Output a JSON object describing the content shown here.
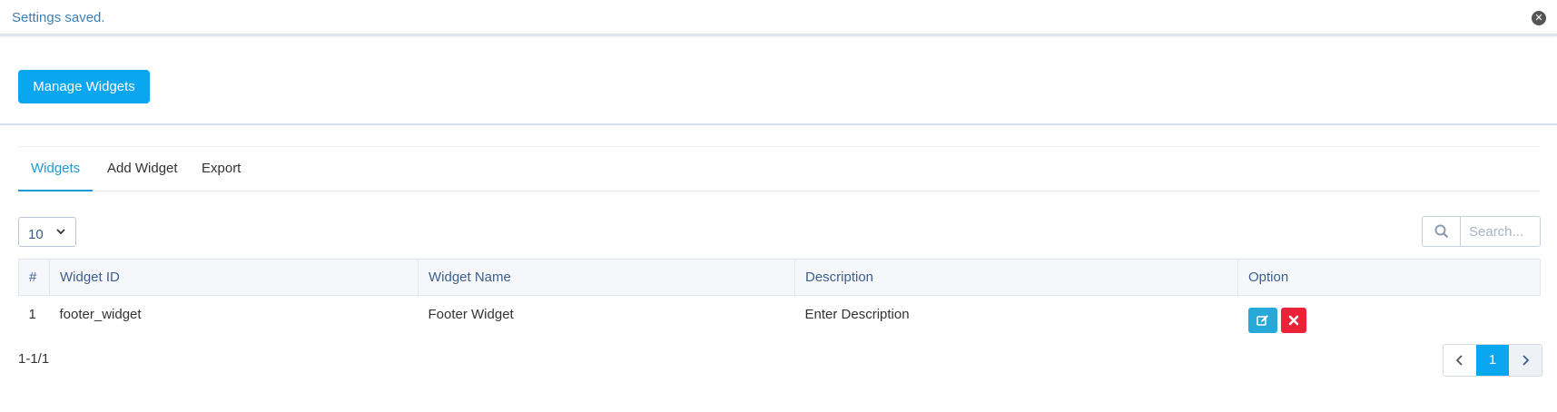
{
  "notice": {
    "text": "Settings saved."
  },
  "header": {
    "manage_label": "Manage Widgets"
  },
  "tabs": [
    {
      "label": "Widgets",
      "active": true
    },
    {
      "label": "Add Widget",
      "active": false
    },
    {
      "label": "Export",
      "active": false
    }
  ],
  "controls": {
    "page_size": "10",
    "search_placeholder": "Search..."
  },
  "table": {
    "columns": [
      "#",
      "Widget ID",
      "Widget Name",
      "Description",
      "Option"
    ],
    "rows": [
      {
        "num": "1",
        "widget_id": "footer_widget",
        "widget_name": "Footer Widget",
        "description": "Enter Description"
      }
    ]
  },
  "pagination": {
    "summary": "1-1/1",
    "current_page": "1"
  },
  "icons": {
    "close": "close-circle-icon",
    "search": "search-icon",
    "chevron": "chevron-down-icon",
    "edit": "edit-icon",
    "delete": "delete-x-icon",
    "prev": "chevron-left-icon",
    "next": "chevron-right-icon"
  },
  "colors": {
    "primary": "#0ba6f0",
    "edit": "#26a9d8",
    "delete": "#ea2339",
    "notice_text": "#3d7fb6"
  }
}
